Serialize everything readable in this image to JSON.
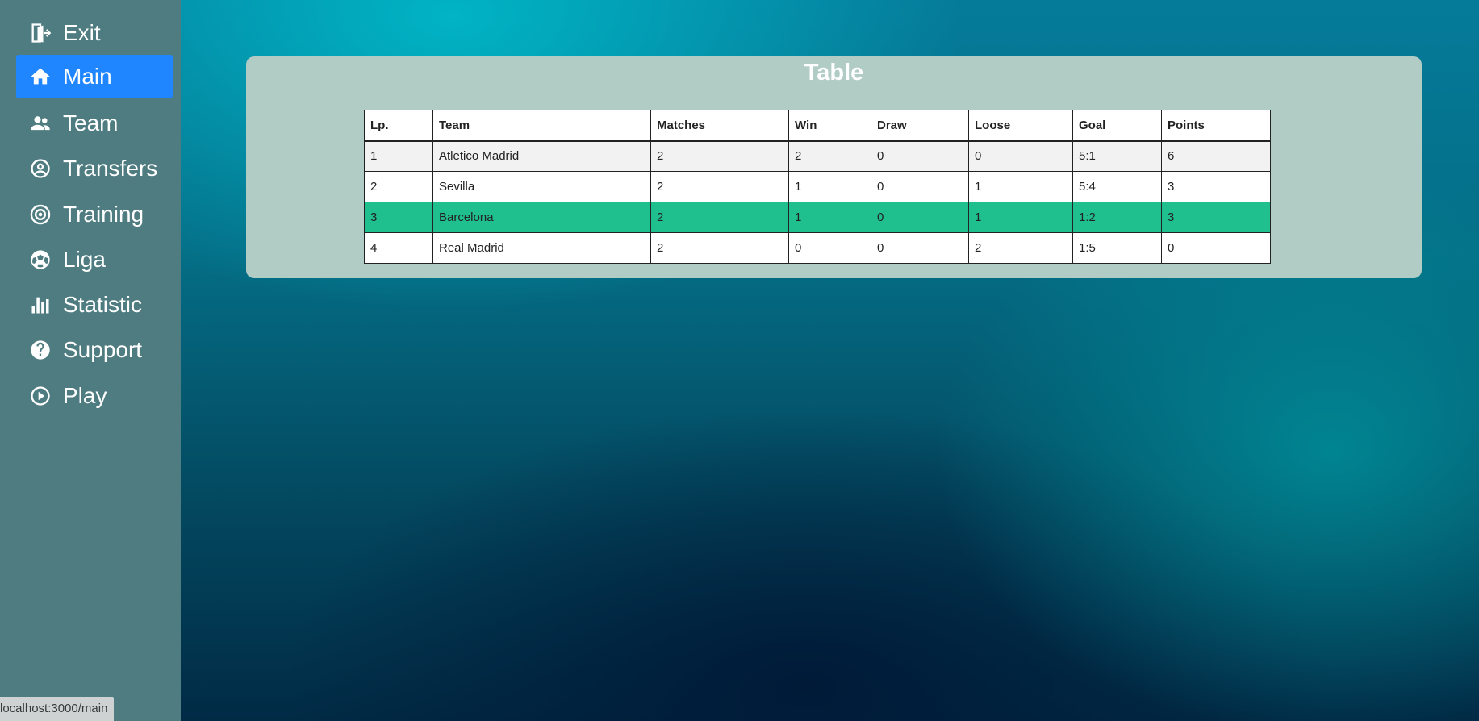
{
  "sidebar": {
    "items": [
      {
        "label": "Exit",
        "icon": "exit-icon",
        "active": false
      },
      {
        "label": "Main",
        "icon": "home-icon",
        "active": true
      },
      {
        "label": "Team",
        "icon": "people-icon",
        "active": false
      },
      {
        "label": "Transfers",
        "icon": "user-circle-icon",
        "active": false
      },
      {
        "label": "Training",
        "icon": "target-icon",
        "active": false
      },
      {
        "label": "Liga",
        "icon": "soccer-ball-icon",
        "active": false
      },
      {
        "label": "Statistic",
        "icon": "bar-chart-icon",
        "active": false
      },
      {
        "label": "Support",
        "icon": "question-icon",
        "active": false
      },
      {
        "label": "Play",
        "icon": "play-circle-icon",
        "active": false
      }
    ],
    "active_color": "#1f86ff",
    "background": "#4e7c80"
  },
  "main": {
    "title": "Table",
    "table": {
      "headers": [
        "Lp.",
        "Team",
        "Matches",
        "Win",
        "Draw",
        "Loose",
        "Goal",
        "Points"
      ],
      "rows": [
        [
          "1",
          "Atletico Madrid",
          "2",
          "2",
          "0",
          "0",
          "5:1",
          "6"
        ],
        [
          "2",
          "Sevilla",
          "2",
          "1",
          "0",
          "1",
          "5:4",
          "3"
        ],
        [
          "3",
          "Barcelona",
          "2",
          "1",
          "0",
          "1",
          "1:2",
          "3"
        ],
        [
          "4",
          "Real Madrid",
          "2",
          "0",
          "0",
          "2",
          "1:5",
          "0"
        ]
      ],
      "highlight_team": "Barcelona",
      "highlight_color": "#20c08e"
    }
  },
  "status_bar": {
    "url": "localhost:3000/main"
  }
}
